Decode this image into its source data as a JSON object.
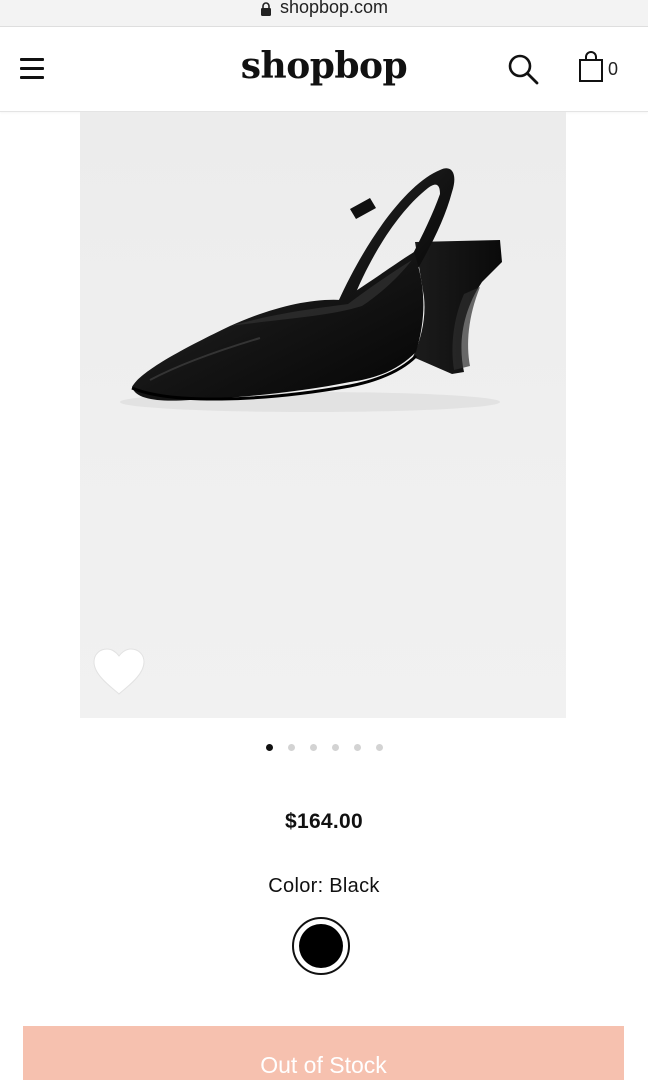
{
  "browser": {
    "url": "shopbop.com",
    "lock_icon": "lock-icon"
  },
  "header": {
    "logo": "shopbop",
    "menu_icon": "hamburger-menu-icon",
    "search_icon": "search-icon",
    "bag_icon": "shopping-bag-icon",
    "bag_count": "0"
  },
  "product": {
    "image_alt": "Black pointed-toe slingback pump with sculpted block heel",
    "favorite_icon": "heart-icon",
    "carousel": {
      "total": 6,
      "active_index": 0
    },
    "price": "$164.00",
    "color_label": "Color: Black",
    "swatches": [
      {
        "name": "Black",
        "hex": "#000000",
        "selected": true
      }
    ],
    "stock_button": "Out of Stock"
  },
  "colors": {
    "stock_button_bg": "#f6c1af",
    "swatch_black": "#000000",
    "active_dot": "#111111",
    "inactive_dot": "#d3d3d3"
  }
}
